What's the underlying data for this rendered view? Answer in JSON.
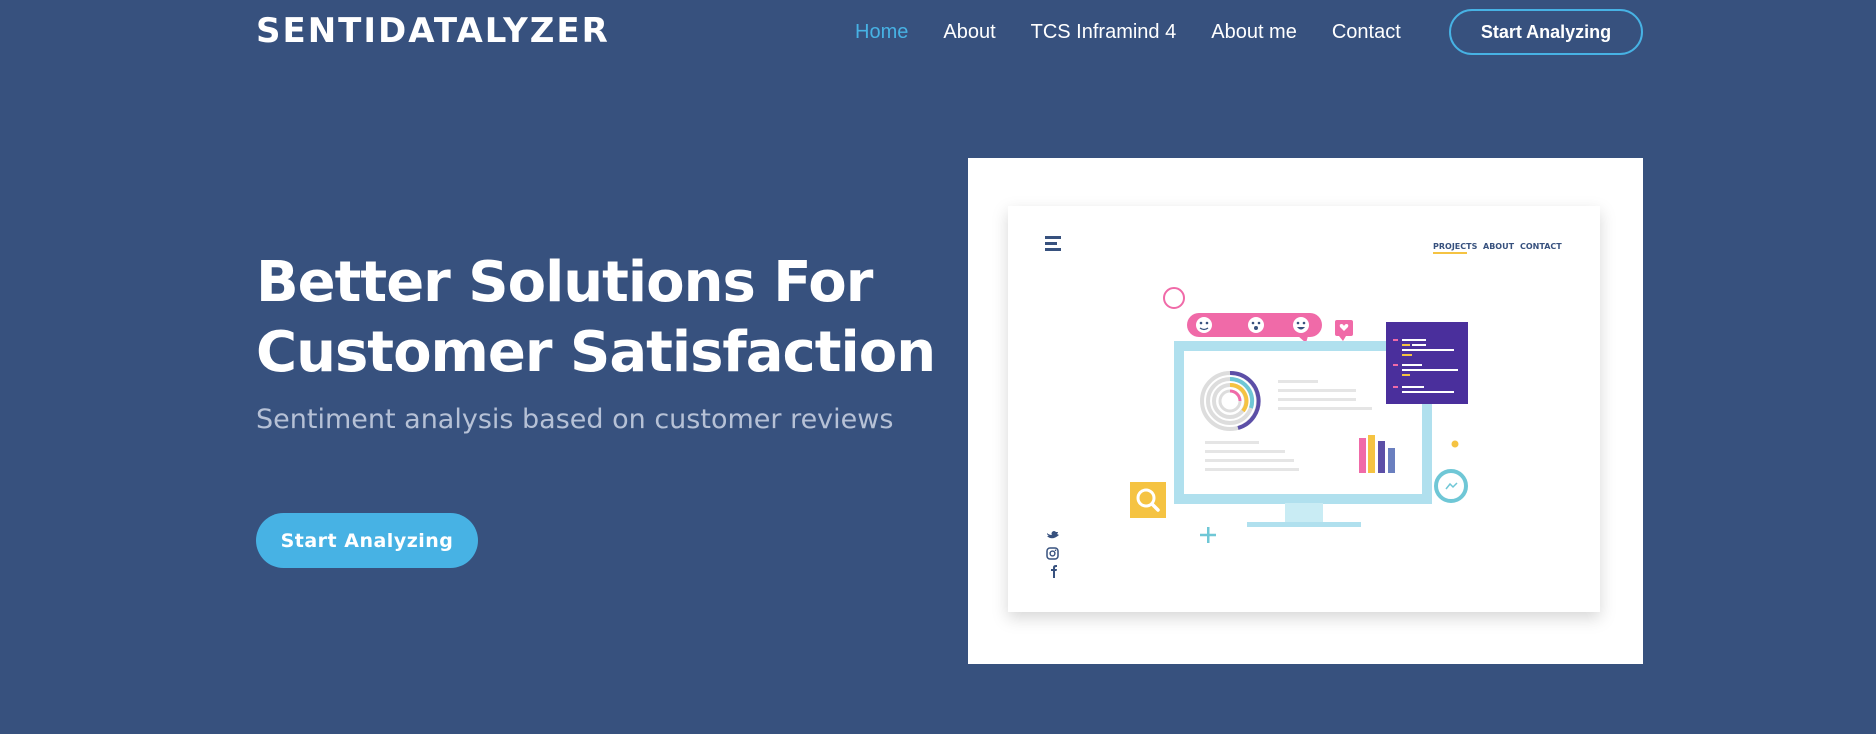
{
  "header": {
    "logo": "SENTIDATALYZER",
    "nav": [
      {
        "label": "Home",
        "active": true
      },
      {
        "label": "About",
        "active": false
      },
      {
        "label": "TCS Inframind 4",
        "active": false
      },
      {
        "label": "About me",
        "active": false
      },
      {
        "label": "Contact",
        "active": false
      }
    ],
    "cta_label": "Start Analyzing"
  },
  "hero": {
    "title_line1": "Better Solutions For",
    "title_line2": "Customer Satisfaction",
    "subtitle": "Sentiment analysis based on customer reviews",
    "cta_label": "Start Analyzing"
  },
  "illustration": {
    "nav": [
      "PROJECTS",
      "ABOUT",
      "CONTACT"
    ],
    "icons": [
      "menu-icon",
      "twitter-icon",
      "instagram-icon",
      "facebook-icon",
      "search-icon",
      "messenger-icon",
      "heart-icon",
      "plus-icon"
    ]
  },
  "colors": {
    "background": "#37517e",
    "accent": "#47b2e4",
    "subtitle": "#b6c1d6"
  }
}
